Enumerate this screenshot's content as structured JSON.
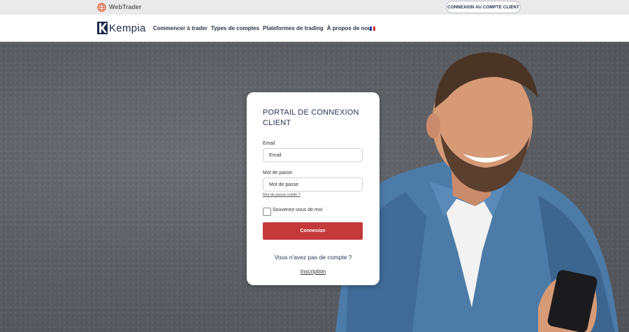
{
  "topbar": {
    "webtrader_label": "WebTrader",
    "client_login_button": "CONNEXION AU COMPTE CLIENT"
  },
  "nav": {
    "brand": "Kempia",
    "links": [
      "Commencer à trader",
      "Types de comptes",
      "Plateformes de trading",
      "À propos de nous"
    ],
    "language_flag": "fr-flag-icon"
  },
  "login_card": {
    "title": "PORTAIL DE CONNEXION CLIENT",
    "email_label": "Email",
    "email_placeholder": "Email",
    "password_label": "Mot de passe",
    "password_placeholder": "Mot de passe",
    "forgot_password": "Mot de passe oublié ?",
    "remember_me": "Souvenez-vous de moi",
    "submit": "Connexion",
    "no_account": "Vous n'avez pas de compte ?",
    "signup": "Inscription"
  },
  "colors": {
    "accent_red": "#c4393a",
    "brand_navy": "#1c2a4a",
    "hero_wall": "#5c5f64"
  }
}
